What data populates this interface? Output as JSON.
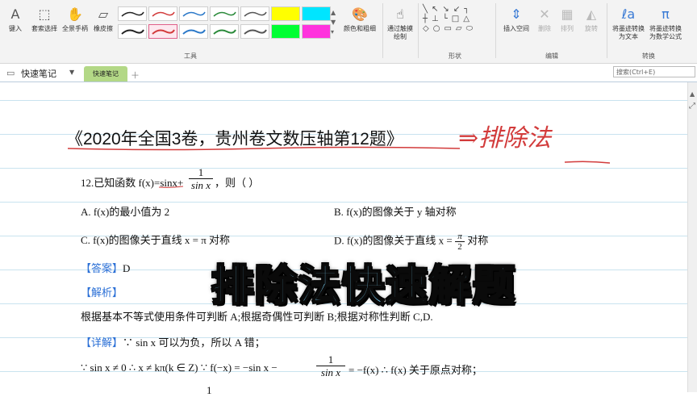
{
  "ribbon": {
    "draw_tools": {
      "type": "键入",
      "lasso": "套索选择",
      "pan": "全景手柄",
      "eraser": "橡皮擦"
    },
    "color_thickness": "颜色和粗细",
    "group_tools": "工具",
    "touch_draw": "通过触摸绘制",
    "group_shapes": "形状",
    "insert_space": "插入空间",
    "delete": "删除",
    "arrange": "排列",
    "rotate": "旋转",
    "group_edit": "编辑",
    "ink_to_text": "将墨迹转换为文本",
    "ink_to_math": "将墨迹转换为数学公式",
    "group_convert": "转换",
    "pen_colors": [
      "#222222",
      "#d23b3b",
      "#2a78c8",
      "#2a8a3a",
      "#555555"
    ],
    "highlight_colors": [
      "#ffff00",
      "#00e5ff",
      "#00ff33",
      "#ff33dd"
    ]
  },
  "notebook": {
    "name": "快速笔记",
    "tab": "快速笔记",
    "search_placeholder": "搜索(Ctrl+E)"
  },
  "note": {
    "title": "《2020年全国3卷，贵州卷文数压轴第12题》",
    "handwriting": "⇒排除法",
    "q_num_stem": "12.已知函数 f(x)=sinx+",
    "frac1_num": "1",
    "frac1_den": "sin x",
    "q_tail": "，则（      ）",
    "optA": "A. f(x)的最小值为 2",
    "optB": "B. f(x)的图像关于 y 轴对称",
    "optC": "C. f(x)的图像关于直线 x = π 对称",
    "optD_pre": "D. f(x)的图像关于直线 x =",
    "optD_num": "π",
    "optD_den": "2",
    "optD_post": "对称",
    "answer_label": "【答案】",
    "answer_value": "D",
    "analysis_label": "【解析】",
    "analysis_text": "根据基本不等式使用条件可判断 A;根据奇偶性可判断 B;根据对称性判断 C,D.",
    "detail_label": "【详解】",
    "detail_text": "∵ sin x 可以为负，所以 A 错；",
    "proof_pre": "∵ sin x ≠ 0 ∴ x ≠ kπ(k ∈ Z) ∵ f(−x) = −sin x −",
    "proof_num": "1",
    "proof_den": "sin x",
    "proof_post": "= −f(x) ∴ f(x) 关于原点对称；",
    "cut_num": "1"
  },
  "overlay_text": "排除法快速解题"
}
